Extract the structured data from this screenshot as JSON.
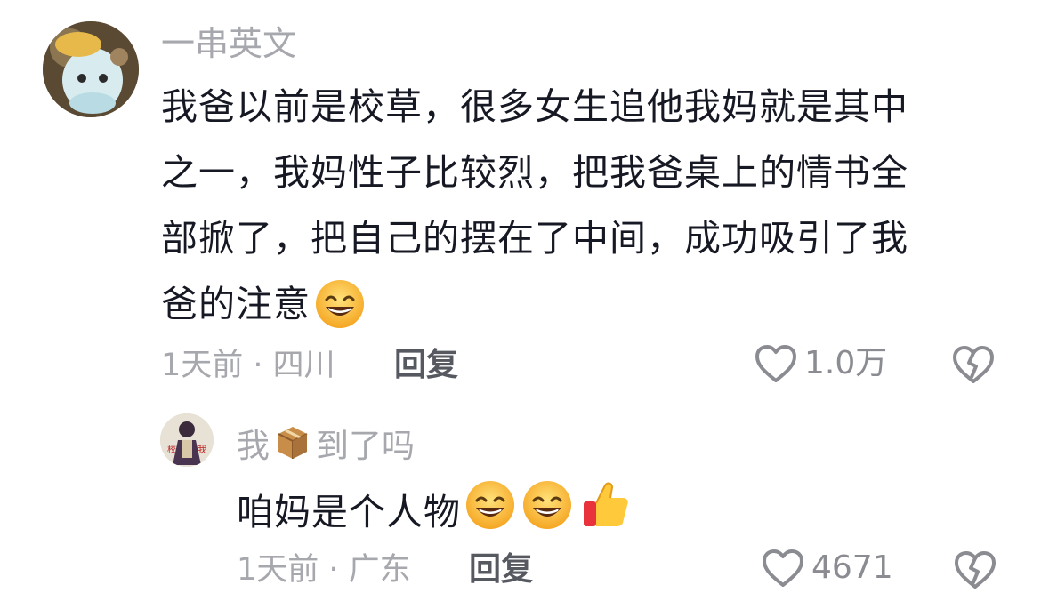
{
  "comment": {
    "username": "一串英文",
    "text": "我爸以前是校草，很多女生追他我妈就是其中\n之一，我妈性子比较烈，把我爸桌上的情书全\n部掀了，把自己的摆在了中间，成功吸引了我\n爸的注意",
    "text_emojis": [
      "grinning-face-emoji"
    ],
    "meta": "1天前 · 四川",
    "reply_label": "回复",
    "like_count": "1.0万"
  },
  "reply": {
    "username_before": "我",
    "username_emoji": "package-emoji",
    "username_after": "到了吗",
    "text": "咱妈是个人物",
    "text_emojis": [
      "grinning-face-emoji",
      "grinning-face-emoji",
      "thumbs-up-emoji"
    ],
    "meta": "1天前 · 广东",
    "reply_label": "回复",
    "like_count": "4671"
  },
  "colors": {
    "text": "#161823",
    "secondary": "#a6a8ad",
    "reply": "#565960"
  }
}
